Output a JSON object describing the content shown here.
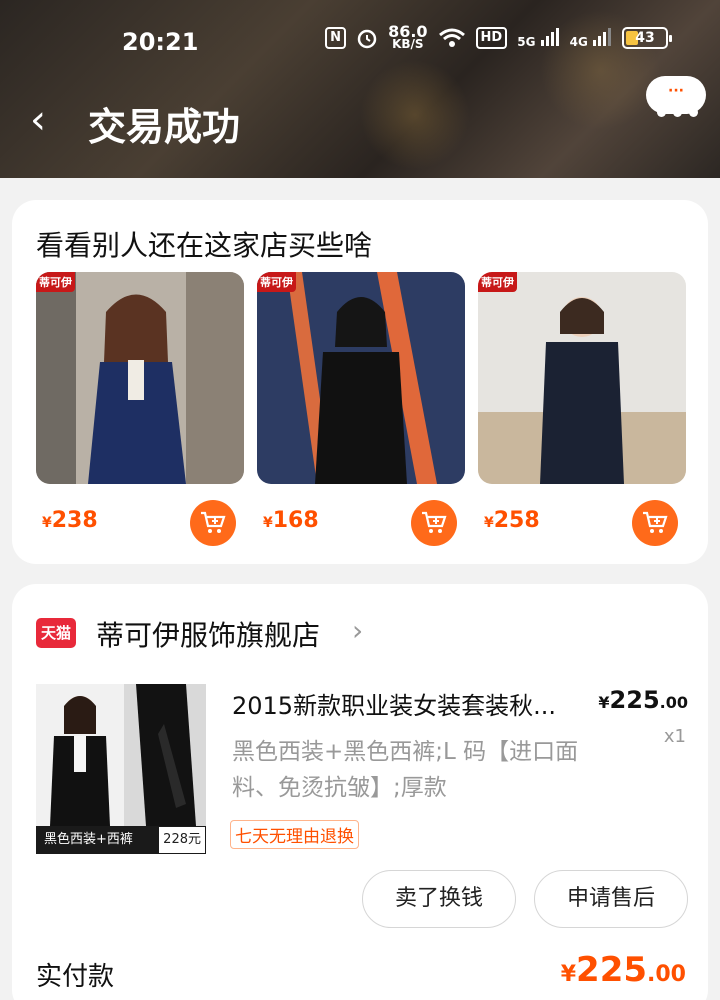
{
  "status_bar": {
    "time": "20:21",
    "nfc": "N",
    "speed_value": "86.0",
    "speed_unit": "KB/S",
    "hd": "HD",
    "net1": "5G",
    "net2": "4G",
    "battery": "43"
  },
  "header": {
    "title": "交易成功",
    "back_icon": "back-arrow-icon",
    "menu_bubble": "···"
  },
  "recommendations": {
    "title": "看看别人还在这家店买些啥",
    "items": [
      {
        "tag": "蒂可伊",
        "price": "238",
        "currency": "¥"
      },
      {
        "tag": "蒂可伊",
        "price": "168",
        "currency": "¥"
      },
      {
        "tag": "蒂可伊",
        "price": "258",
        "currency": "¥"
      }
    ]
  },
  "order": {
    "shop_logo": "天猫",
    "shop_name": "蒂可伊服饰旗舰店",
    "product": {
      "title": "2015新款职业装女装套装秋...",
      "price_currency": "¥",
      "price_main": "225",
      "price_decimal": ".00",
      "quantity": "x1",
      "spec": "黑色西装+黑色西裤;L 码【进口面料、免烫抗皱】;厚款",
      "image_caption": "黑色西装+西裤",
      "image_price": "228元",
      "return_badge": "七天无理由退换"
    },
    "buttons": {
      "sell": "卖了换钱",
      "after_sale": "申请售后"
    },
    "paid": {
      "label": "实付款",
      "currency": "¥",
      "main": "225",
      "decimal": ".00"
    }
  },
  "colors": {
    "accent": "#ff5000",
    "cart_button": "#ff6a1a",
    "tmall_red": "#e8293a"
  }
}
